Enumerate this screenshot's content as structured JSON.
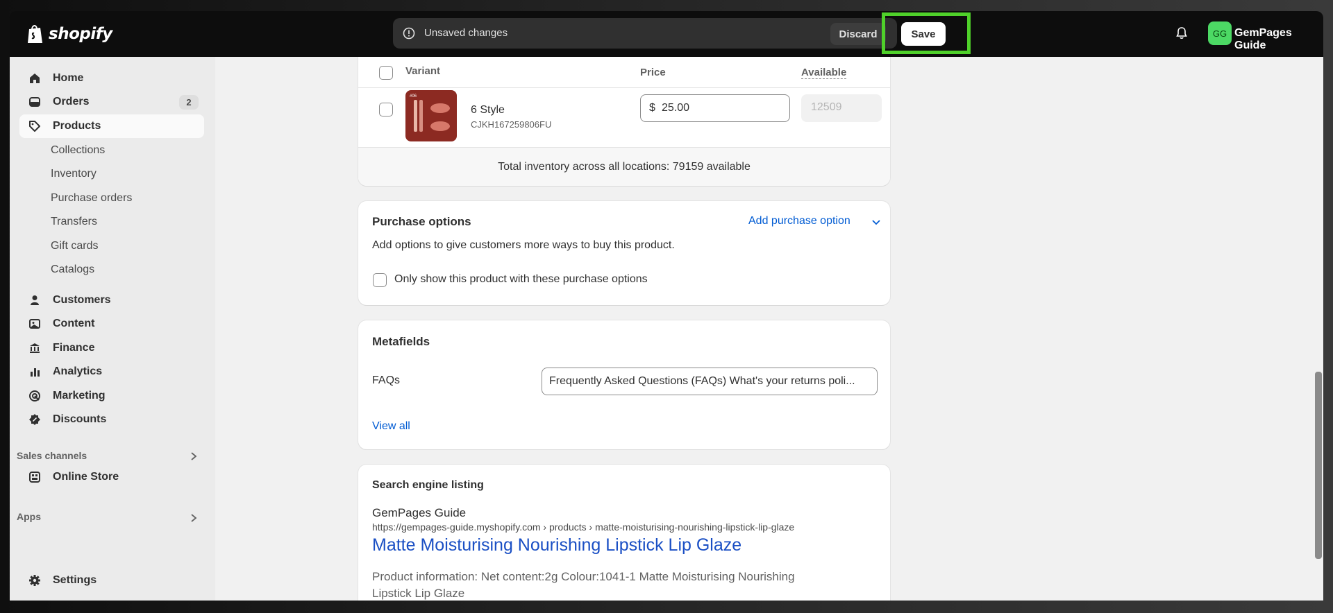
{
  "topbar": {
    "brand": "shopify",
    "unsaved_text": "Unsaved changes",
    "discard_label": "Discard",
    "save_label": "Save",
    "avatar_initials": "GG",
    "store_name": "GemPages Guide"
  },
  "sidebar": {
    "items": [
      {
        "label": "Home",
        "icon": "home-icon"
      },
      {
        "label": "Orders",
        "icon": "orders-icon",
        "badge": "2"
      },
      {
        "label": "Products",
        "icon": "tag-icon"
      },
      {
        "label": "Customers",
        "icon": "person-icon"
      },
      {
        "label": "Content",
        "icon": "content-icon"
      },
      {
        "label": "Finance",
        "icon": "bank-icon"
      },
      {
        "label": "Analytics",
        "icon": "bar-chart-icon"
      },
      {
        "label": "Marketing",
        "icon": "target-icon"
      },
      {
        "label": "Discounts",
        "icon": "discount-icon"
      }
    ],
    "product_subitems": [
      "Collections",
      "Inventory",
      "Purchase orders",
      "Transfers",
      "Gift cards",
      "Catalogs"
    ],
    "sales_channels_label": "Sales channels",
    "online_store_label": "Online Store",
    "apps_label": "Apps",
    "settings_label": "Settings"
  },
  "variants": {
    "col_variant": "Variant",
    "col_price": "Price",
    "col_available": "Available",
    "row": {
      "name": "6 Style",
      "sku": "CJKH167259806FU",
      "currency": "$",
      "price": "25.00",
      "available": "12509"
    },
    "total_inventory": "Total inventory across all locations: 79159 available"
  },
  "purchase_options": {
    "title": "Purchase options",
    "add_link": "Add purchase option",
    "description": "Add options to give customers more ways to buy this product.",
    "checkbox_label": "Only show this product with these purchase options"
  },
  "metafields": {
    "title": "Metafields",
    "faq_label": "FAQs",
    "faq_value": "Frequently Asked Questions (FAQs) What's your returns poli...",
    "view_all": "View all"
  },
  "seo": {
    "title": "Search engine listing",
    "store": "GemPages Guide",
    "url": "https://gempages-guide.myshopify.com › products › matte-moisturising-nourishing-lipstick-lip-glaze",
    "page_title": "Matte Moisturising Nourishing Lipstick Lip Glaze",
    "desc_line1": "Product information: Net content:2g Colour:1041-1 Matte Moisturising Nourishing",
    "desc_line2": "Lipstick Lip Glaze"
  },
  "colors": {
    "highlight": "#4fd12a",
    "link": "#005bd3",
    "arrow_top": "#2ab5b5",
    "arrow_bottom": "#8ee68a"
  }
}
